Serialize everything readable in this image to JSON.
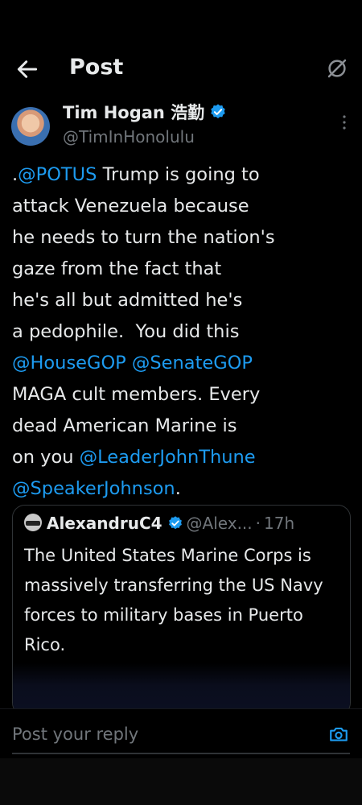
{
  "header": {
    "title": "Post",
    "back_icon": "arrow-left-icon",
    "reader_icon": "reader-mode-off-icon"
  },
  "author": {
    "name": "Tim Hogan 浩勤",
    "handle": "@TimInHonolulu",
    "verified_color": "#1d9bf0"
  },
  "post": {
    "segments": [
      {
        "text": ".",
        "mention": false
      },
      {
        "text": "@POTUS",
        "mention": true
      },
      {
        "text": " Trump is going to\nattack Venezuela because\nhe needs to turn the nation's\ngaze from the fact that\nhe's all but admitted he's\na pedophile.  You did this\n",
        "mention": false
      },
      {
        "text": "@HouseGOP",
        "mention": true
      },
      {
        "text": " ",
        "mention": false
      },
      {
        "text": "@SenateGOP",
        "mention": true
      },
      {
        "text": "\nMAGA cult members. Every\ndead American Marine is\non you ",
        "mention": false
      },
      {
        "text": "@LeaderJohnThune",
        "mention": true
      },
      {
        "text": "\n",
        "mention": false
      },
      {
        "text": "@SpeakerJohnson",
        "mention": true
      },
      {
        "text": ".",
        "mention": false
      }
    ]
  },
  "quote": {
    "name": "AlexandruC4",
    "handle": "@Alex...",
    "separator": "·",
    "time": "17h",
    "text": "The United States Marine Corps is massively transferring the US Navy forces to military bases in Puerto Rico."
  },
  "reply": {
    "placeholder": "Post your reply",
    "camera_icon": "camera-icon"
  },
  "colors": {
    "accent": "#1d9bf0",
    "background": "#000000",
    "secondary_text": "#71767b"
  }
}
